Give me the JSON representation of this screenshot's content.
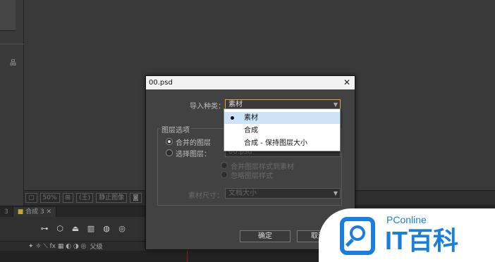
{
  "viewer": {
    "zoom": "50%",
    "toggle_label": "静止图像",
    "mask": "(王)"
  },
  "tabs": [
    "3",
    "合成 3"
  ],
  "timeline": {
    "parent_label": "父级"
  },
  "dialog": {
    "title": "00.psd",
    "close_label": "✕",
    "import_kind_label": "导入种类：",
    "import_kind_value": "素材",
    "layer_options_label": "图层选项",
    "merged_layers_label": "合并的图层",
    "choose_layer_label": "选择图层：",
    "choose_layer_value": "00.psd",
    "merge_styles_label": "合并图层样式到素材",
    "ignore_styles_label": "忽略图层样式",
    "footage_size_label": "素材尺寸：",
    "footage_size_value": "文档大小",
    "ok_label": "确定",
    "cancel_label": "取消"
  },
  "dropdown": {
    "options": [
      {
        "label": "素材",
        "selected": true
      },
      {
        "label": "合成",
        "selected": false
      },
      {
        "label": "合成 - 保持图层大小",
        "selected": false
      }
    ]
  },
  "logo": {
    "brand_small": "PConline",
    "brand_large": "IT百科",
    "color": "#1a7de0"
  }
}
